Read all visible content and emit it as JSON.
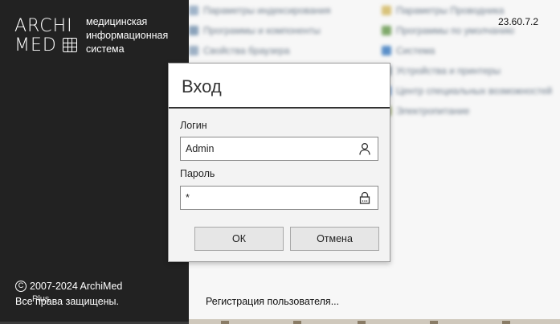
{
  "app": {
    "logo_top": "ARCHI",
    "logo_bottom": "MED",
    "tagline_lines": [
      "медицинская",
      "информационная",
      "система"
    ],
    "version": "23.60.7.2",
    "copyright": "2007-2024 ArchiMed",
    "rights": "Все права защищены.",
    "overlay_text": "Plus",
    "register_link": "Регистрация пользователя..."
  },
  "dialog": {
    "title": "Вход",
    "login_label": "Логин",
    "login_value": "Admin",
    "password_label": "Пароль",
    "password_value": "*",
    "ok_label": "ОК",
    "cancel_label": "Отмена"
  },
  "background": {
    "items_left": [
      "Параметры индексирования",
      "Программы и компоненты",
      "Свойства браузера"
    ],
    "items_right": [
      "Параметры Проводника",
      "Программы по умолчанию",
      "Система",
      "Устройства и принтеры",
      "Центр специальных возможностей",
      "Электропитание"
    ]
  },
  "icons": {
    "login_field": "user-icon",
    "password_field": "lock-icon",
    "copyright": "copyright-icon"
  },
  "colors": {
    "left_panel": "#222222",
    "dialog_bg": "#f3f3f3",
    "dialog_divider": "#333333"
  }
}
